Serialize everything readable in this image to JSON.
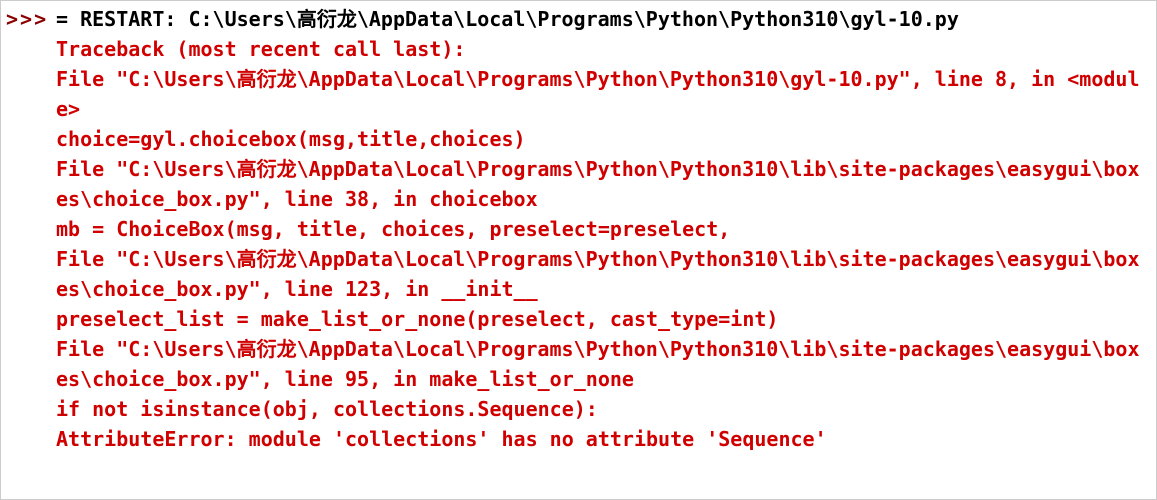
{
  "prompt": ">>>",
  "restart_line": "= RESTART: C:\\Users\\高衍龙\\AppData\\Local\\Programs\\Python\\Python310\\gyl-10.py",
  "traceback": {
    "header": "Traceback (most recent call last):",
    "frames": [
      {
        "file_line": "  File \"C:\\Users\\高衍龙\\AppData\\Local\\Programs\\Python\\Python310\\gyl-10.py\", line 8, in <module>",
        "code_line": "    choice=gyl.choicebox(msg,title,choices)"
      },
      {
        "file_line": "  File \"C:\\Users\\高衍龙\\AppData\\Local\\Programs\\Python\\Python310\\lib\\site-packages\\easygui\\boxes\\choice_box.py\", line 38, in choicebox",
        "code_line": "    mb = ChoiceBox(msg, title, choices, preselect=preselect,"
      },
      {
        "file_line": "  File \"C:\\Users\\高衍龙\\AppData\\Local\\Programs\\Python\\Python310\\lib\\site-packages\\easygui\\boxes\\choice_box.py\", line 123, in __init__",
        "code_line": "    preselect_list = make_list_or_none(preselect, cast_type=int)"
      },
      {
        "file_line": "  File \"C:\\Users\\高衍龙\\AppData\\Local\\Programs\\Python\\Python310\\lib\\site-packages\\easygui\\boxes\\choice_box.py\", line 95, in make_list_or_none",
        "code_line": "    if not isinstance(obj, collections.Sequence):"
      }
    ],
    "error": "AttributeError: module 'collections' has no attribute 'Sequence'"
  }
}
